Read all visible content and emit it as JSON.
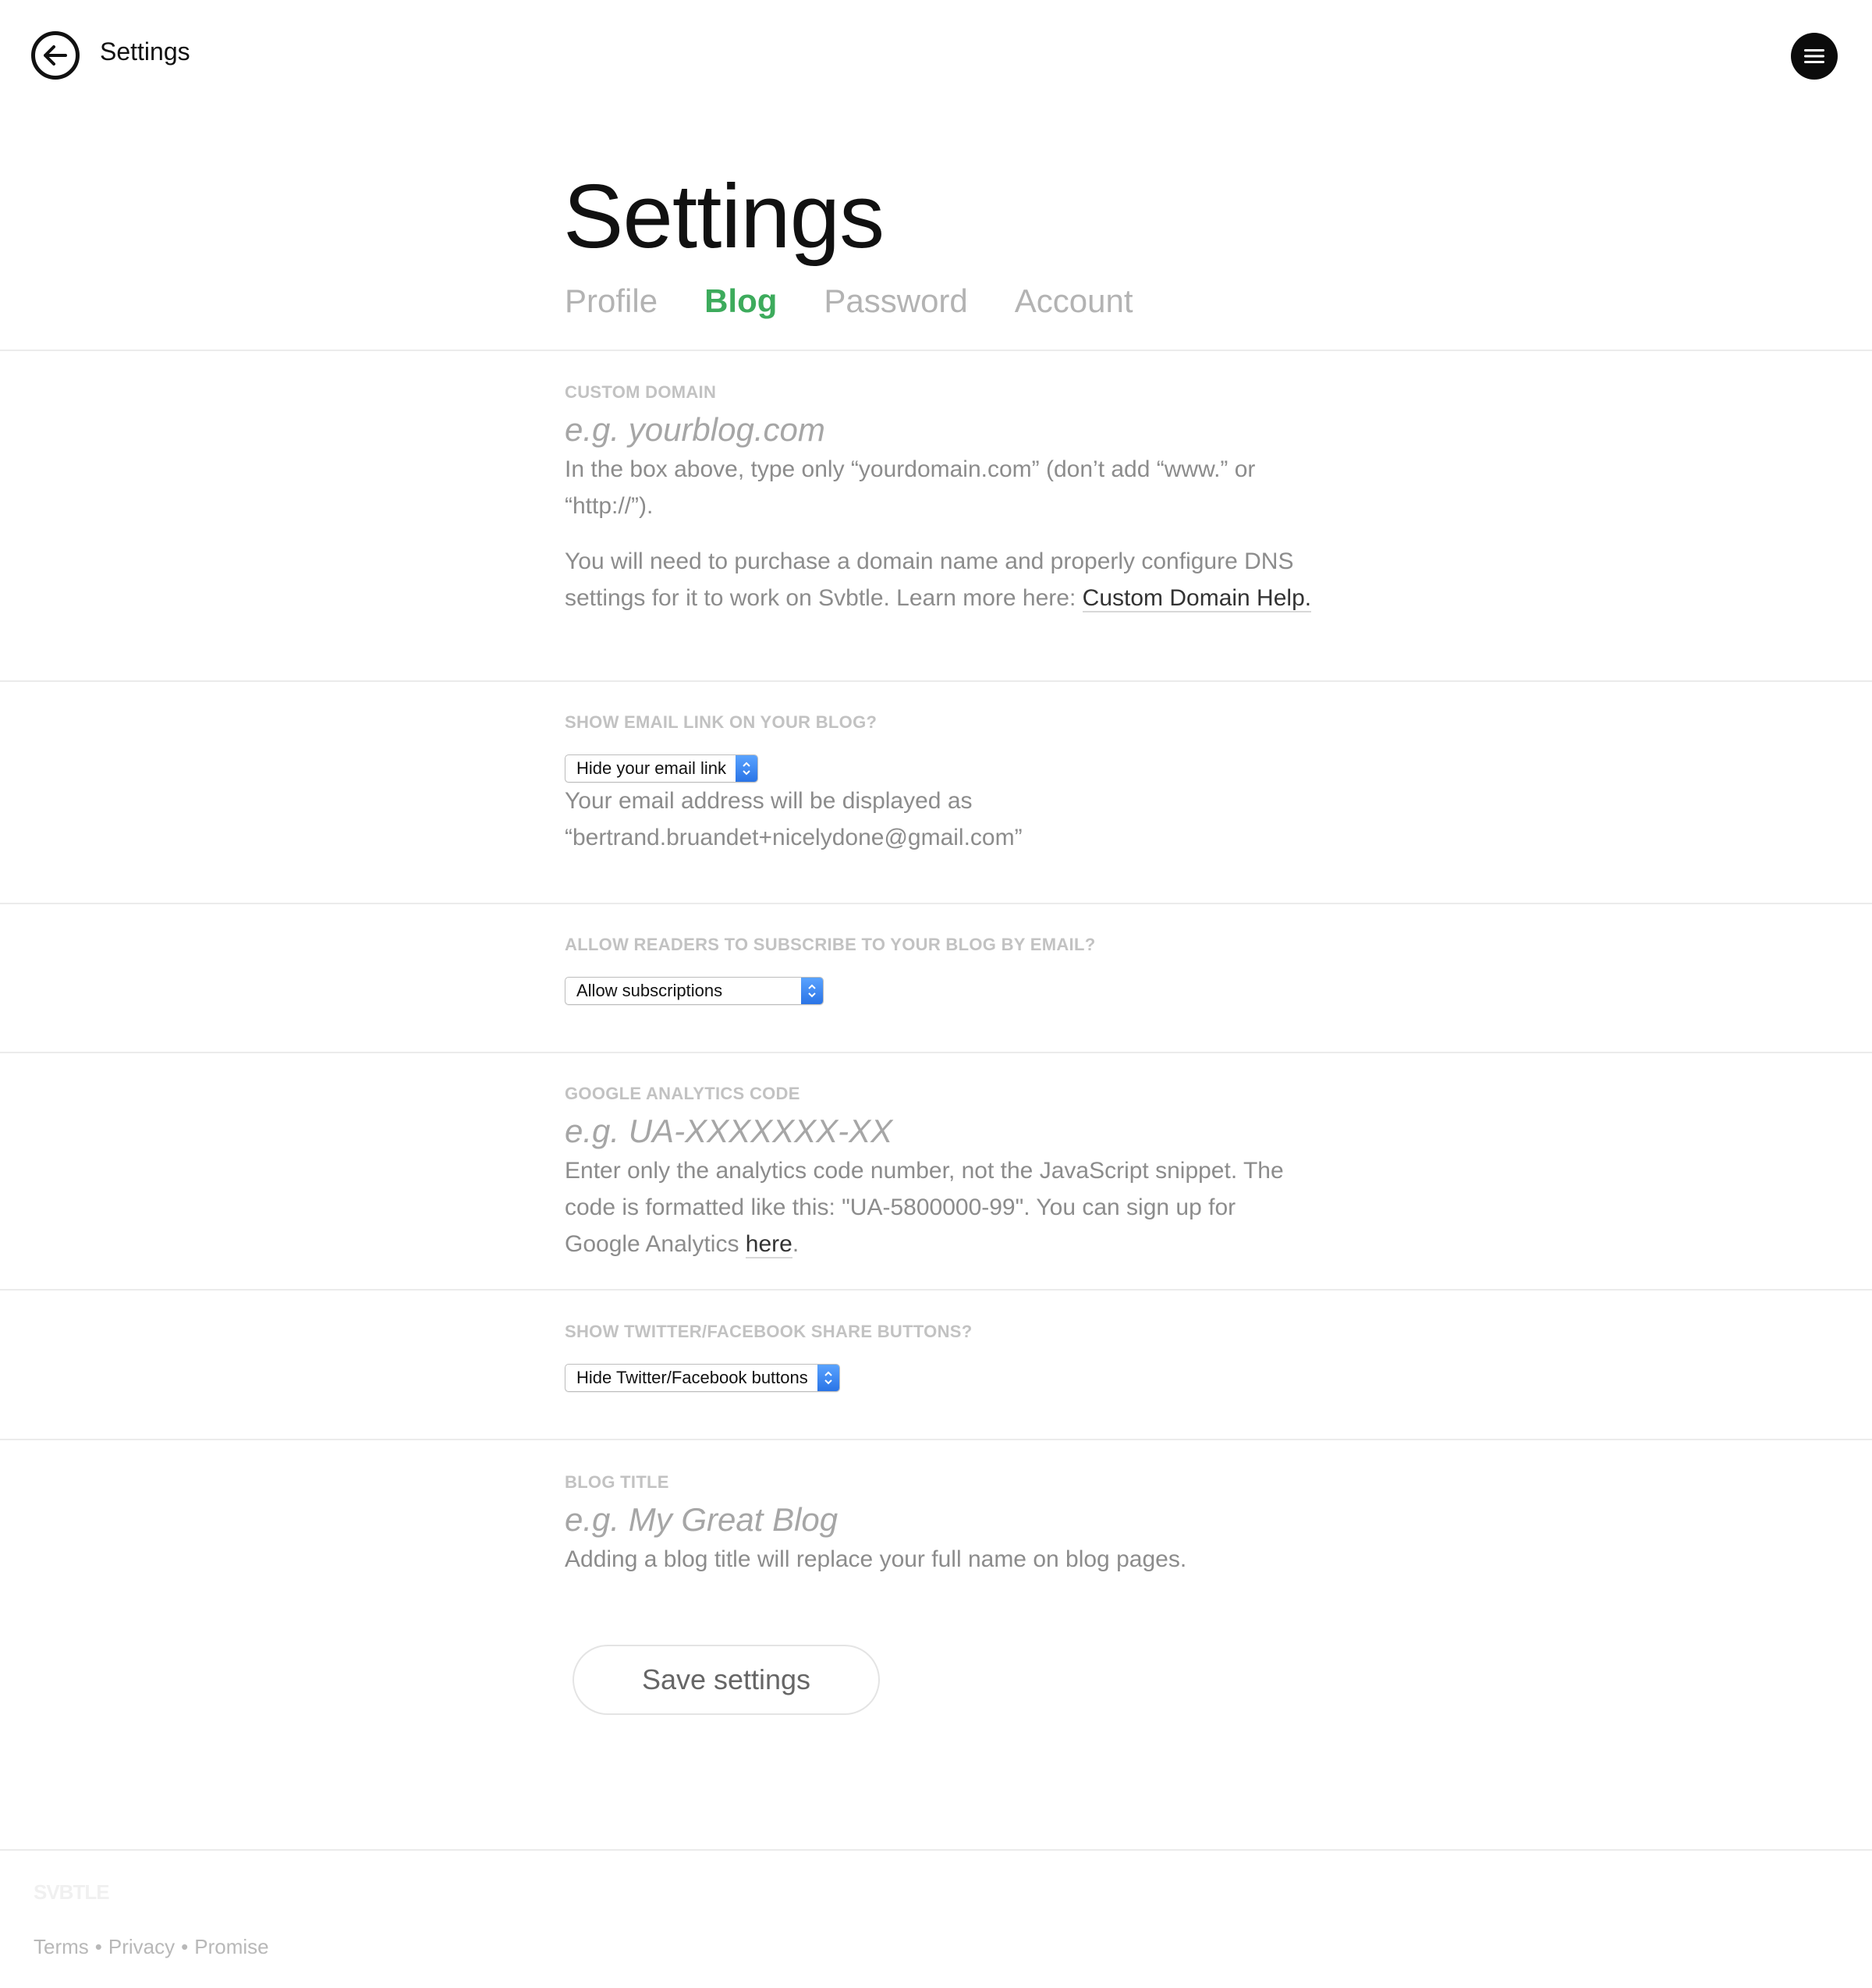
{
  "topbar": {
    "back_icon": "arrow-left-circle-icon",
    "title": "Settings",
    "menu_icon": "hamburger-menu-icon"
  },
  "header": {
    "title": "Settings",
    "tabs": [
      {
        "label": "Profile",
        "active": false
      },
      {
        "label": "Blog",
        "active": true
      },
      {
        "label": "Password",
        "active": false
      },
      {
        "label": "Account",
        "active": false
      }
    ],
    "accent_color": "#3dab5c"
  },
  "custom_domain": {
    "label": "CUSTOM DOMAIN",
    "placeholder": "e.g. yourblog.com",
    "value": "",
    "help_1": "In the box above, type only “yourdomain.com” (don’t add “www.” or “http://”).",
    "help_2_prefix": "You will need to purchase a domain name and properly configure DNS settings for it to work on Svbtle. Learn more here: ",
    "help_2_link": "Custom Domain Help."
  },
  "email_link": {
    "label": "SHOW EMAIL LINK ON YOUR BLOG?",
    "selected": "Hide your email link",
    "help_line_1": "Your email address will be displayed as",
    "help_line_2": "“bertrand.bruandet+nicelydone@gmail.com”"
  },
  "subscriptions": {
    "label": "ALLOW READERS TO SUBSCRIBE TO YOUR BLOG BY EMAIL?",
    "selected": "Allow subscriptions"
  },
  "analytics": {
    "label": "GOOGLE ANALYTICS CODE",
    "placeholder": "e.g. UA-XXXXXXX-XX",
    "value": "",
    "help_prefix": "Enter only the analytics code number, not the JavaScript snippet. The code is formatted like this: \"UA-5800000-99\". You can sign up for Google Analytics ",
    "help_link": "here",
    "help_suffix": "."
  },
  "share_buttons": {
    "label": "SHOW TWITTER/FACEBOOK SHARE BUTTONS?",
    "selected": "Hide Twitter/Facebook buttons"
  },
  "blog_title": {
    "label": "BLOG TITLE",
    "placeholder": "e.g. My Great Blog",
    "value": "",
    "help": "Adding a blog title will replace your full name on blog pages."
  },
  "save_label": "Save settings",
  "footer": {
    "logo": "SVBTLE",
    "links": [
      "Terms",
      "Privacy",
      "Promise"
    ],
    "separator": "•"
  }
}
